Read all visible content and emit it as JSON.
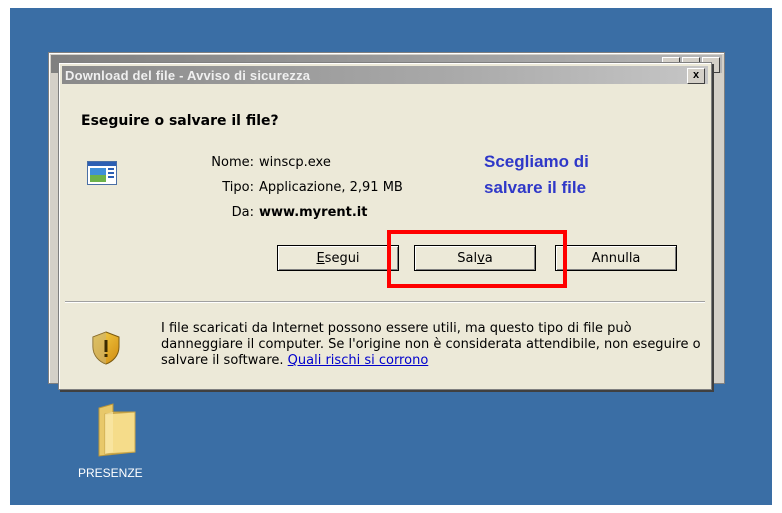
{
  "dialog": {
    "title": "Download del file - Avviso di sicurezza",
    "close_label": "x",
    "heading": "Eseguire o salvare il file?",
    "fields": [
      {
        "label": "Nome:",
        "value": "winscp.exe"
      },
      {
        "label": "Tipo:",
        "value": "Applicazione, 2,91 MB"
      },
      {
        "label": "Da:",
        "value": "www.myrent.it"
      }
    ],
    "buttons": {
      "run": {
        "pre": "",
        "mnemonic": "E",
        "post": "segui"
      },
      "save": {
        "pre": "Sal",
        "mnemonic": "v",
        "post": "a"
      },
      "cancel": "Annulla"
    },
    "warning_text": "I file scaricati da Internet possono essere utili, ma questo tipo di file può danneggiare il computer. Se l'origine non è considerata attendibile, non eseguire o salvare il software.",
    "warning_link": "Quali rischi si corrono"
  },
  "annotation": {
    "line1": "Scegliamo di",
    "line2": "salvare il file",
    "color": "#2f38c8",
    "highlight_color": "#ff0000"
  },
  "desktop": {
    "background": "#3a6ea5",
    "folder_label": "PRESENZE"
  },
  "icons": [
    "file-icon",
    "shield-warning-icon",
    "folder-icon",
    "close-icon"
  ]
}
